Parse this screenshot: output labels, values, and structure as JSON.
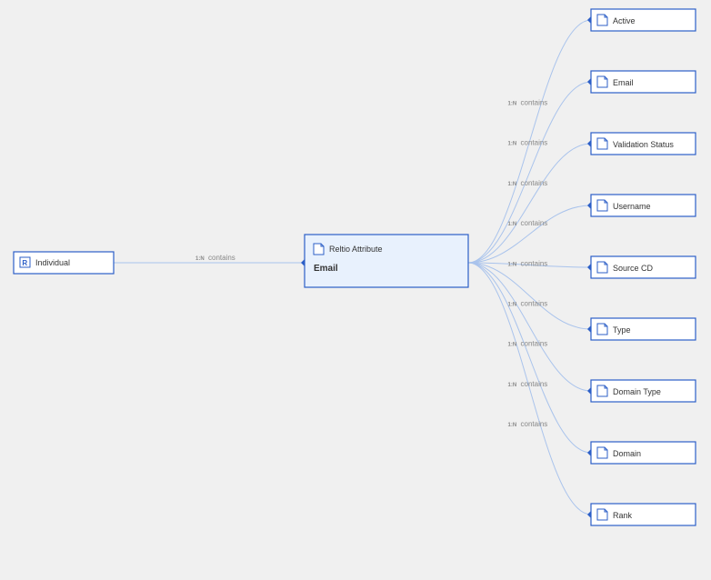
{
  "source": {
    "label": "Individual"
  },
  "centerEdge": {
    "tag": "1:N",
    "label": "contains"
  },
  "center": {
    "super": "Reltio Attribute",
    "title": "Email"
  },
  "fanEdge": {
    "tag": "1:N",
    "label": "contains"
  },
  "attrs": [
    {
      "label": "Active"
    },
    {
      "label": "Email"
    },
    {
      "label": "Validation Status"
    },
    {
      "label": "Username"
    },
    {
      "label": "Source CD"
    },
    {
      "label": "Type"
    },
    {
      "label": "Domain Type"
    },
    {
      "label": "Domain"
    },
    {
      "label": "Rank"
    }
  ]
}
